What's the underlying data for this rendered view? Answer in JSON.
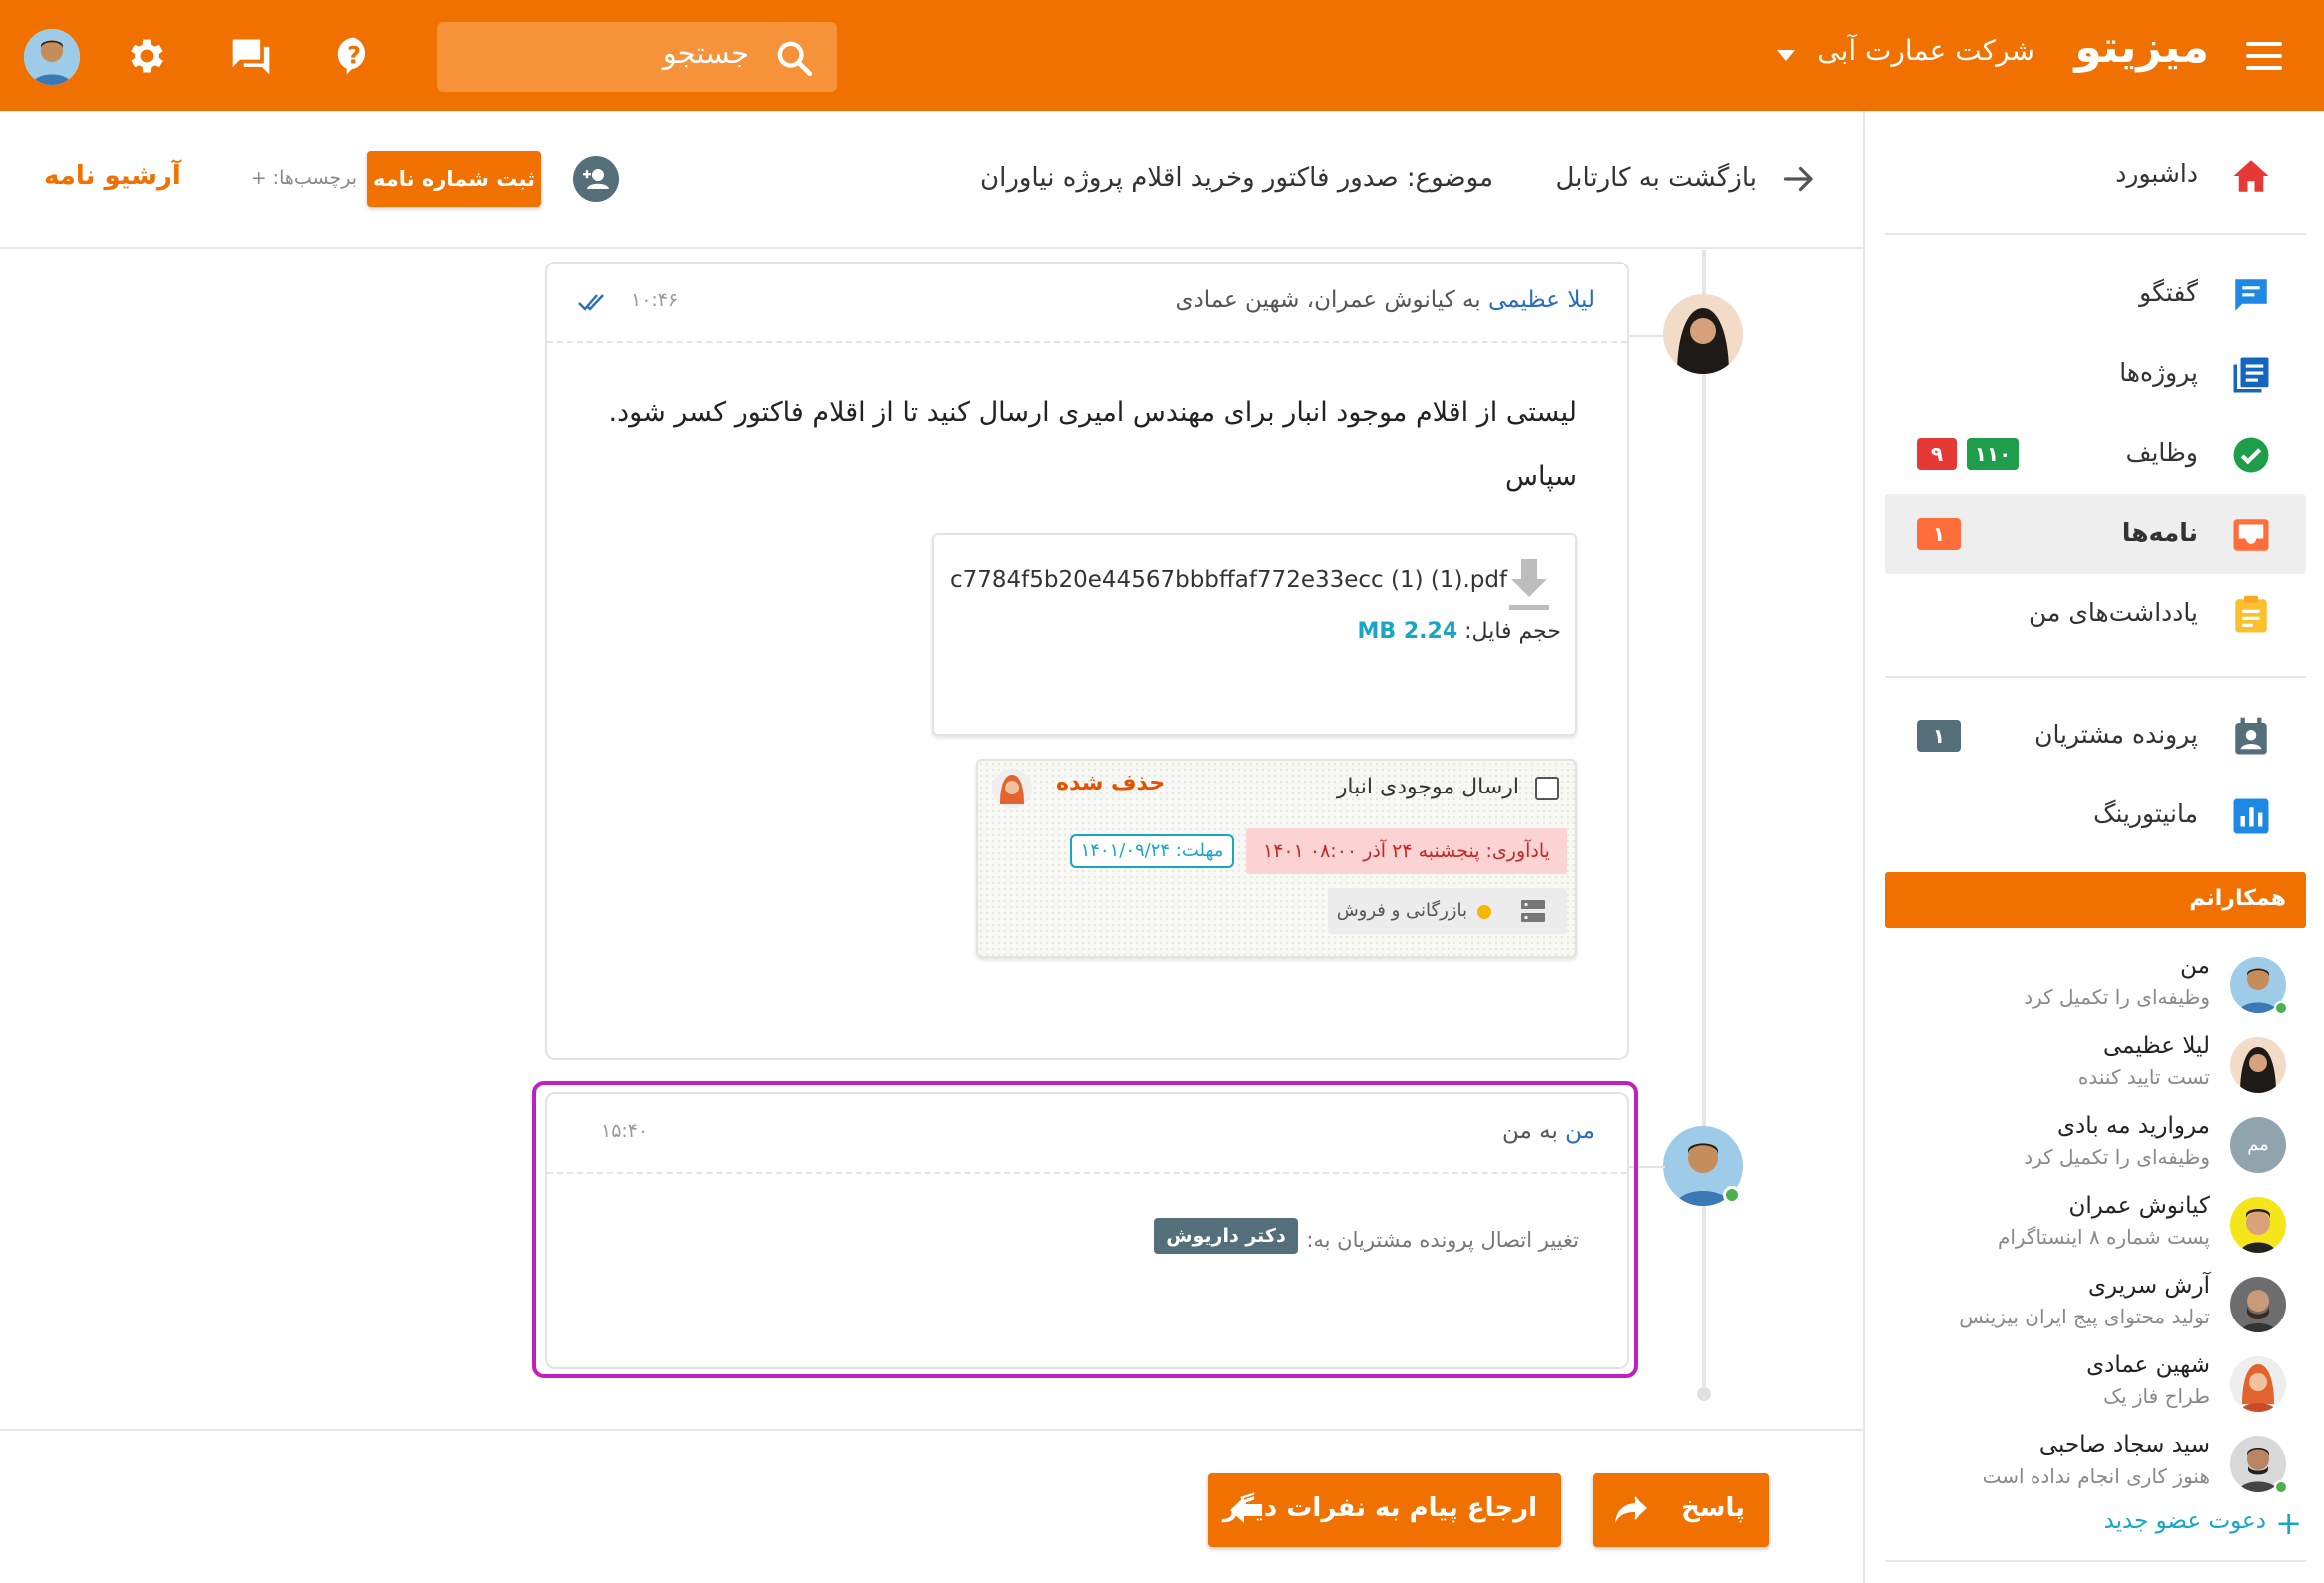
{
  "app": {
    "logo": "میزیتو",
    "company": "شرکت عمارت آبی",
    "search_placeholder": "جستجو"
  },
  "icons": {
    "menu": "hamburger-icon",
    "search": "search-icon",
    "help": "help-icon",
    "chat": "chat-icon",
    "settings": "gear-icon",
    "avatar": "user-avatar"
  },
  "colors": {
    "brand": "#f07000",
    "link": "#2a6ebb",
    "accent": "#1aa5c4",
    "highlight": "#c020c0"
  },
  "sidebar": {
    "items": [
      {
        "label": "داشبورد",
        "icon": "home-icon",
        "color": "#e53935"
      },
      {
        "label": "گفتگو",
        "icon": "message-icon",
        "color": "#1e88e5"
      },
      {
        "label": "پروژه‌ها",
        "icon": "projects-icon",
        "color": "#1565c0"
      },
      {
        "label": "وظایف",
        "icon": "tasks-check-icon",
        "color": "#1e9e4a",
        "badges": [
          "۱۱۰",
          "۹"
        ]
      },
      {
        "label": "نامه‌ها",
        "icon": "inbox-icon",
        "color": "#ff6d3a",
        "badges": [
          "۱"
        ],
        "active": true
      },
      {
        "label": "یادداشت‌های من",
        "icon": "notes-icon",
        "color": "#fbc02d"
      },
      {
        "label": "پرونده مشتریان",
        "icon": "customer-file-icon",
        "color": "#546e7a",
        "badges": [
          "۱"
        ]
      },
      {
        "label": "مانیتورینگ",
        "icon": "chart-icon",
        "color": "#1e88e5"
      }
    ],
    "team_header": "همکارانم",
    "members": [
      {
        "name": "من",
        "desc": "وظیفه‌ای را تکمیل کرد",
        "online": true
      },
      {
        "name": "لیلا عظیمی",
        "desc": "تست تایید کننده",
        "online": false
      },
      {
        "name": "مروارید مه بادی",
        "desc": "وظیفه‌ای را تکمیل کرد",
        "initials": "مم",
        "online": false
      },
      {
        "name": "کیانوش عمران",
        "desc": "پست شماره ۸ اینستاگرام",
        "online": false
      },
      {
        "name": "آرش سریری",
        "desc": "تولید محتوای پیج ایران بیزینس",
        "online": false
      },
      {
        "name": "شهین عمادی",
        "desc": "طراح فاز یک",
        "online": false
      },
      {
        "name": "سید سجاد صاحبی",
        "desc": "هنوز کاری انجام نداده است",
        "online": true
      }
    ],
    "invite": "دعوت عضو جدید"
  },
  "subheader": {
    "back": "بازگشت به کارتابل",
    "subject": "موضوع: صدور فاکتور وخرید اقلام پروژه نیاوران",
    "register_button": "ثبت شماره نامه",
    "tags": "برچسب‌ها: +",
    "archive": "آرشیو نامه"
  },
  "messages": [
    {
      "sender": "لیلا عظیمی",
      "recipients": " به کیانوش عمران، شهین عمادی",
      "time": "۱۰:۴۶",
      "body": "لیستی از اقلام موجود انبار برای مهندس امیری ارسال کنید تا از اقلام فاکتور کسر شود.",
      "signoff": "سپاس",
      "attachment": {
        "name": "c7784f5b20e44567bbbffaf772e33ecc (1) (1).pdf",
        "size_label": "حجم فایل: ",
        "size_value": "2.24 MB"
      },
      "task": {
        "title": "ارسال موجودی انبار",
        "status": "حذف شده",
        "reminder": "یادآوری: پنجشنبه ۲۴ آذر ۰۸:۰۰ ۱۴۰۱",
        "deadline": "مهلت: ۱۴۰۱/۰۹/۲۴",
        "project": "بازرگانی و فروش"
      }
    },
    {
      "sender": "من",
      "recipients": " به من",
      "time": "۱۵:۴۰",
      "change_text": "تغییر اتصال پرونده مشتریان به:",
      "chip": "دکتر داریوش"
    }
  ],
  "actions": {
    "reply": "پاسخ",
    "forward": "ارجاع پیام به نفرات دیگر"
  }
}
